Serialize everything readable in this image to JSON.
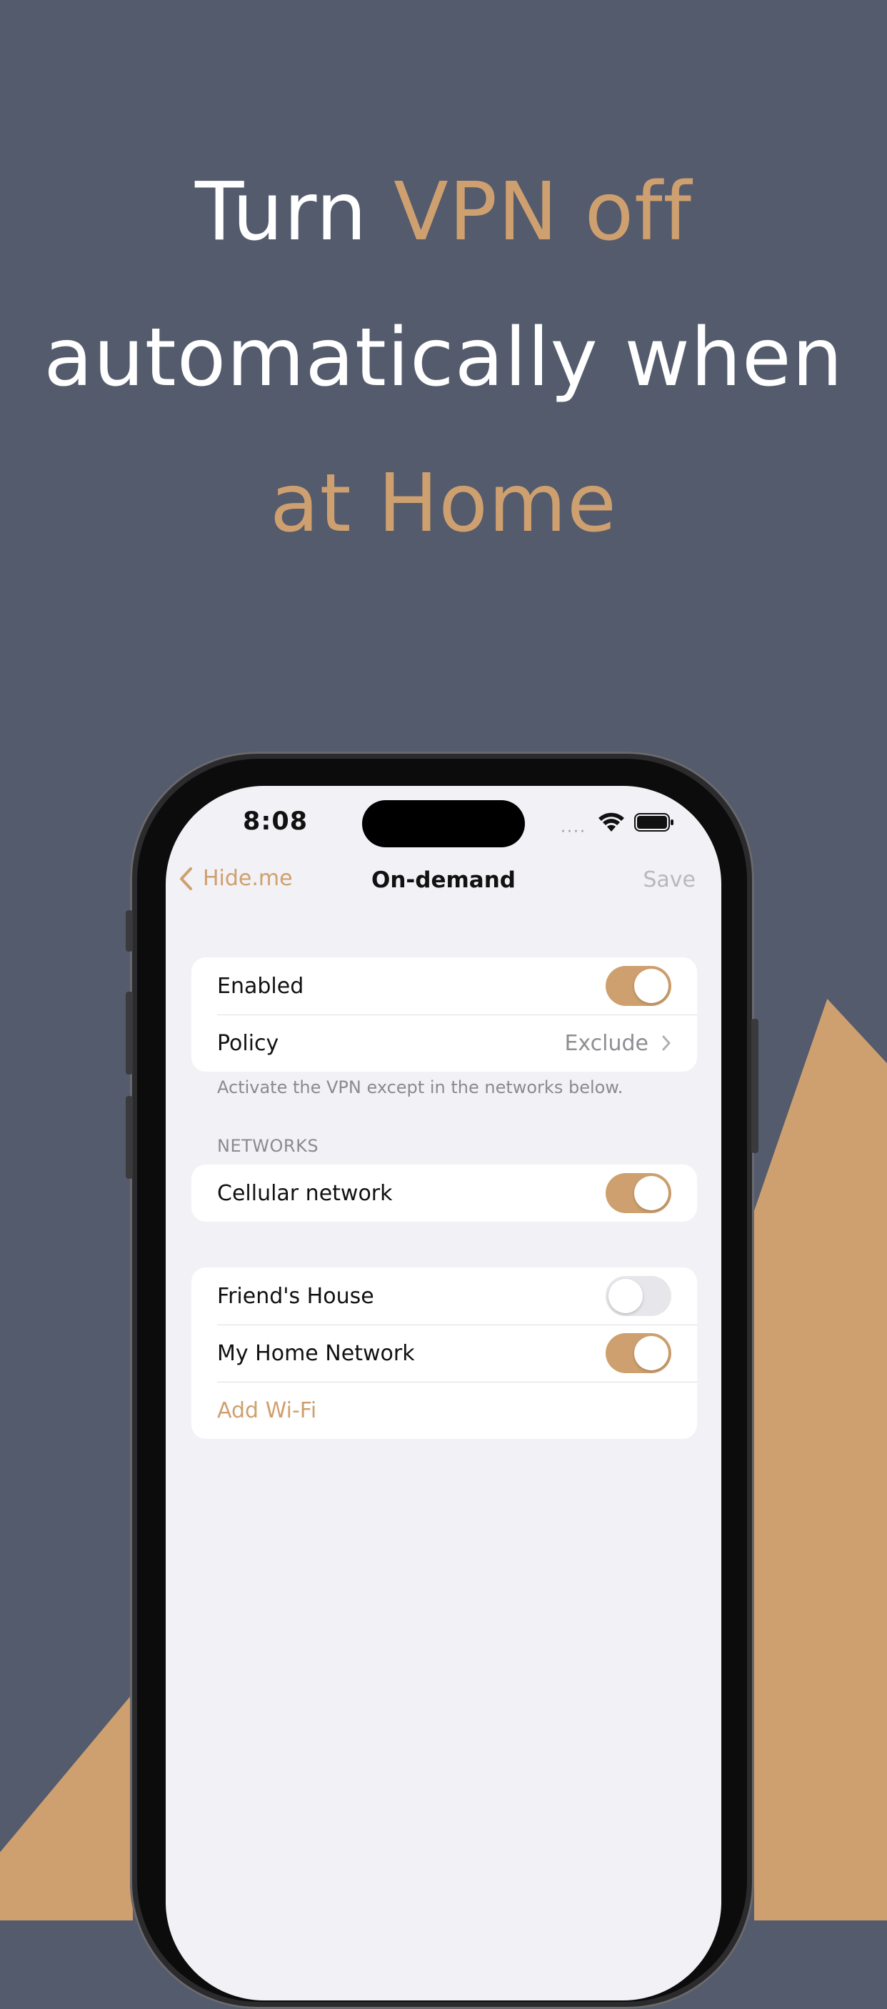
{
  "headline": {
    "line1_plain": "Turn ",
    "line1_accent": "VPN off",
    "line2": "automatically when",
    "line3_accent": "at Home"
  },
  "status_bar": {
    "time": "8:08",
    "signal": "····",
    "icons": [
      "wifi-icon",
      "battery-icon"
    ]
  },
  "nav": {
    "back_label": "Hide.me",
    "title": "On-demand",
    "save_label": "Save"
  },
  "settings": {
    "enabled_label": "Enabled",
    "enabled_on": true,
    "policy_label": "Policy",
    "policy_value": "Exclude",
    "policy_footnote": "Activate the VPN except in the networks below."
  },
  "networks": {
    "section_header": "NETWORKS",
    "cellular_label": "Cellular network",
    "cellular_on": true,
    "wifi": [
      {
        "label": "Friend's House",
        "on": false
      },
      {
        "label": "My Home Network",
        "on": true
      }
    ],
    "add_wifi_label": "Add Wi-Fi"
  },
  "colors": {
    "background": "#535b6d",
    "accent": "#cfa06f",
    "screen_background": "#f2f1f6"
  }
}
